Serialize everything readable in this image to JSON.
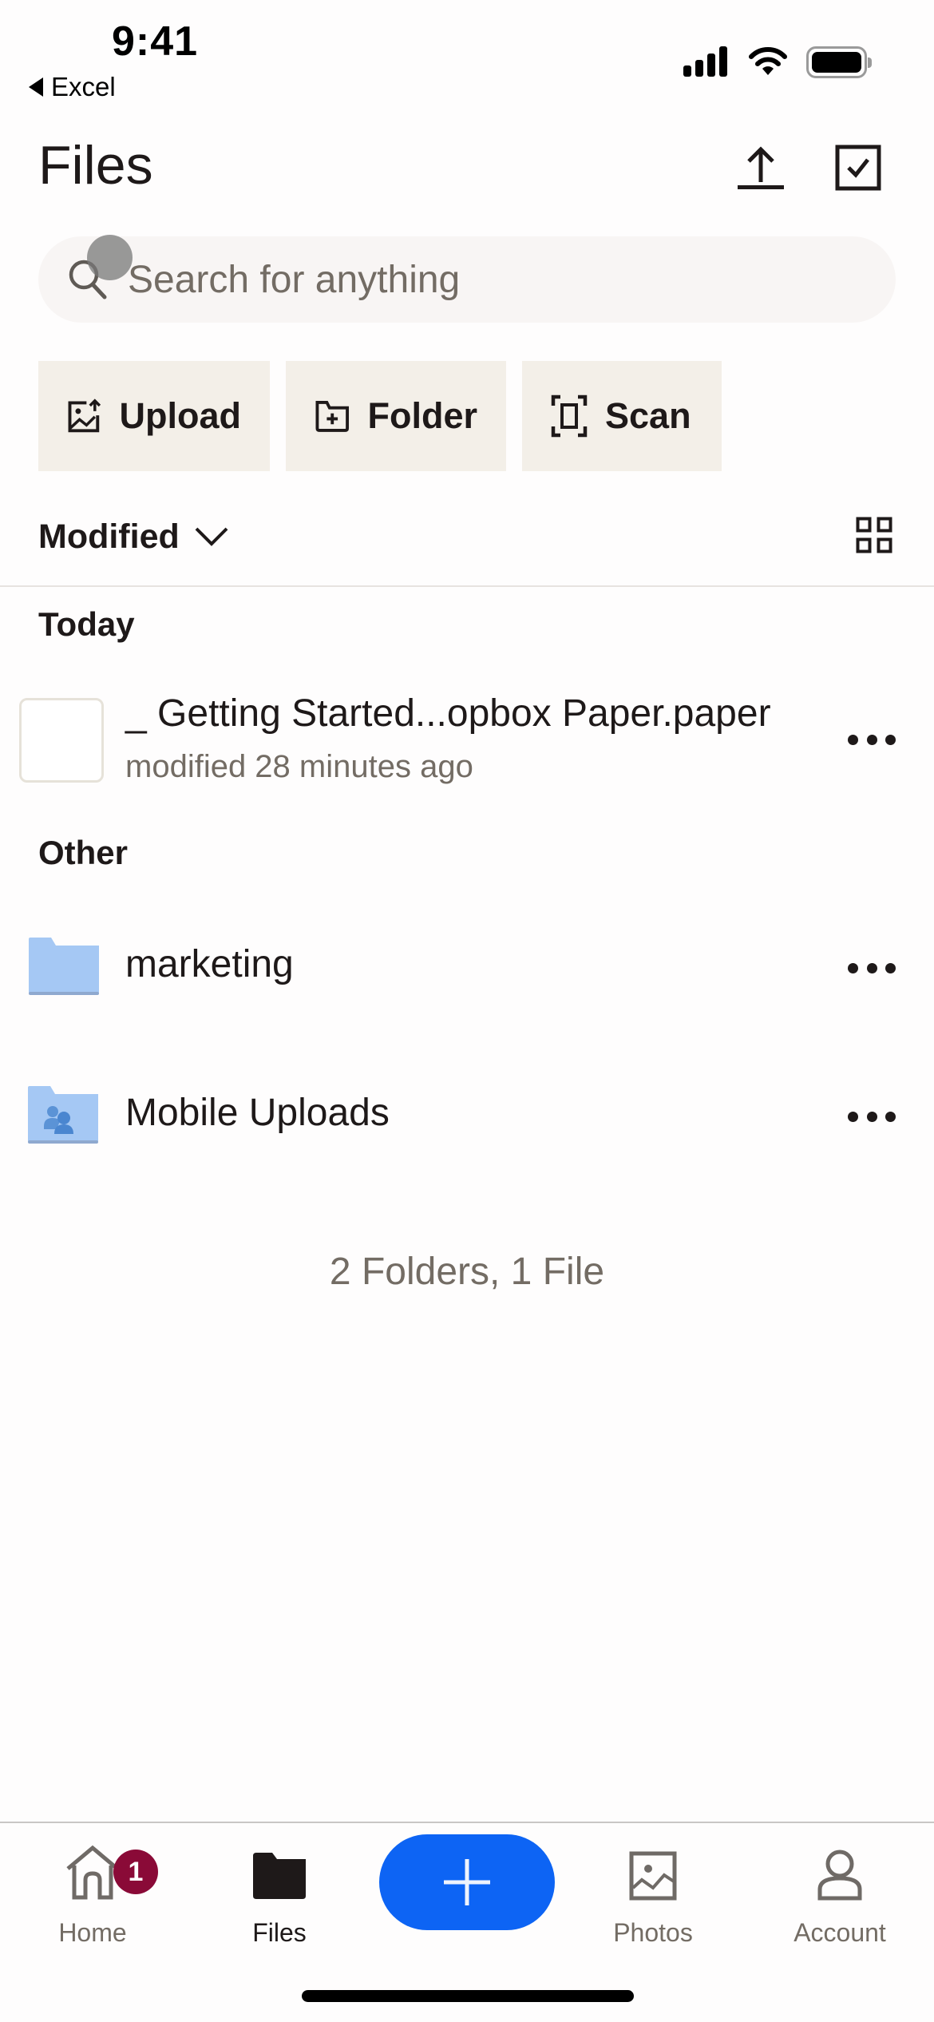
{
  "status_bar": {
    "time": "9:41",
    "back_app": "Excel",
    "signal_icon": "cellular-signal-icon",
    "wifi_icon": "wifi-icon",
    "battery_icon": "battery-icon"
  },
  "header": {
    "title": "Files",
    "upload_icon": "upload-arrow-icon",
    "select_icon": "checkbox-select-icon"
  },
  "search": {
    "placeholder": "Search for anything",
    "value": "",
    "icon": "search-icon"
  },
  "actions": [
    {
      "label": "Upload",
      "icon": "image-upload-icon"
    },
    {
      "label": "Folder",
      "icon": "folder-plus-icon"
    },
    {
      "label": "Scan",
      "icon": "scan-icon"
    }
  ],
  "sort": {
    "label": "Modified",
    "icon": "chevron-down-icon",
    "view_toggle_icon": "grid-view-icon"
  },
  "sections": [
    {
      "label": "Today",
      "items": [
        {
          "name": "_ Getting Started...opbox Paper.paper",
          "subtitle": "modified 28 minutes ago",
          "type": "paper-file",
          "more_icon": "more-options-icon"
        }
      ]
    },
    {
      "label": "Other",
      "items": [
        {
          "name": "marketing",
          "type": "folder",
          "more_icon": "more-options-icon"
        },
        {
          "name": "Mobile Uploads",
          "type": "shared-folder",
          "more_icon": "more-options-icon"
        }
      ]
    }
  ],
  "summary": "2 Folders, 1 File",
  "tabbar": {
    "tabs": [
      {
        "label": "Home",
        "icon": "home-icon",
        "badge": "1",
        "active": false
      },
      {
        "label": "Files",
        "icon": "folder-icon",
        "active": true
      },
      {
        "label": "Photos",
        "icon": "photo-icon",
        "active": false
      },
      {
        "label": "Account",
        "icon": "person-icon",
        "active": false
      }
    ],
    "fab_icon": "plus-icon"
  },
  "colors": {
    "accent": "#0d64f4",
    "badge": "#8a0a37",
    "folder": "#a5c8f4",
    "button_bg": "#f3efe8",
    "text_secondary": "#736c64"
  }
}
